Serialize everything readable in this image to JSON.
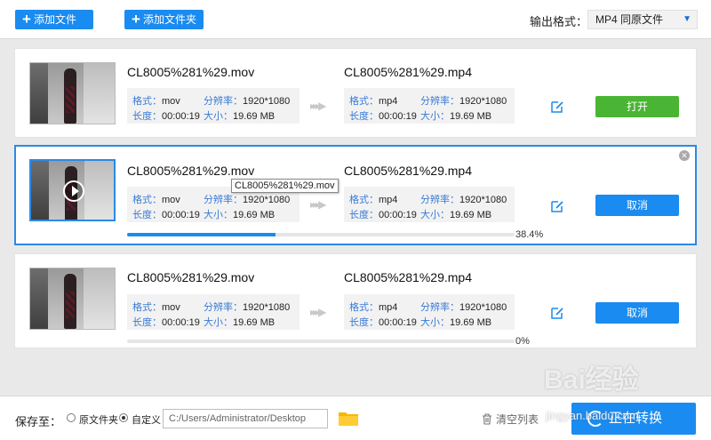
{
  "toolbar": {
    "add_file_label": "添加文件",
    "add_folder_label": "添加文件夹",
    "output_format_label": "输出格式：",
    "output_format_value": "MP4  同原文件"
  },
  "files": [
    {
      "source_name": "CL8005%281%29.mov",
      "target_name": "CL8005%281%29.mp4",
      "src_format_key": "格式：",
      "src_format": "mov",
      "src_res_key": "分辨率：",
      "src_res": "1920*1080",
      "src_len_key": "长度：",
      "src_len": "00:00:19",
      "src_size_key": "大小：",
      "src_size": "19.69 MB",
      "dst_format_key": "格式：",
      "dst_format": "mp4",
      "dst_res_key": "分辨率：",
      "dst_res": "1920*1080",
      "dst_len_key": "长度：",
      "dst_len": "00:00:19",
      "dst_size_key": "大小：",
      "dst_size": "19.69 MB",
      "action_label": "打开"
    },
    {
      "source_name": "CL8005%281%29.mov",
      "target_name": "CL8005%281%29.mp4",
      "tooltip": "CL8005%281%29.mov",
      "src_format_key": "格式：",
      "src_format": "mov",
      "src_res_key": "分辨率：",
      "src_res": "1920*1080",
      "src_len_key": "长度：",
      "src_len": "00:00:19",
      "src_size_key": "大小：",
      "src_size": "19.69 MB",
      "dst_format_key": "格式：",
      "dst_format": "mp4",
      "dst_res_key": "分辨率：",
      "dst_res": "1920*1080",
      "dst_len_key": "长度：",
      "dst_len": "00:00:19",
      "dst_size_key": "大小：",
      "dst_size": "19.69 MB",
      "action_label": "取消",
      "progress": 0.384,
      "progress_label": "38.4%"
    },
    {
      "source_name": "CL8005%281%29.mov",
      "target_name": "CL8005%281%29.mp4",
      "src_format_key": "格式：",
      "src_format": "mov",
      "src_res_key": "分辨率：",
      "src_res": "1920*1080",
      "src_len_key": "长度：",
      "src_len": "00:00:19",
      "src_size_key": "大小：",
      "src_size": "19.69 MB",
      "dst_format_key": "格式：",
      "dst_format": "mp4",
      "dst_res_key": "分辨率：",
      "dst_res": "1920*1080",
      "dst_len_key": "长度：",
      "dst_len": "00:00:19",
      "dst_size_key": "大小：",
      "dst_size": "19.69 MB",
      "action_label": "取消",
      "progress": 0,
      "progress_label": "0%"
    }
  ],
  "bottom": {
    "save_to_label": "保存至：",
    "opt_original": "原文件夹",
    "opt_custom": "自定义",
    "path": "C:/Users/Administrator/Desktop",
    "clear_list": "清空列表",
    "convert_label": "正在转换"
  },
  "watermark": {
    "text": "Bai经验",
    "url": "jingyan.baidu.com"
  },
  "colors": {
    "accent": "#1a8bf0",
    "open_button": "#4ab534",
    "key_text": "#3a7bd5"
  }
}
